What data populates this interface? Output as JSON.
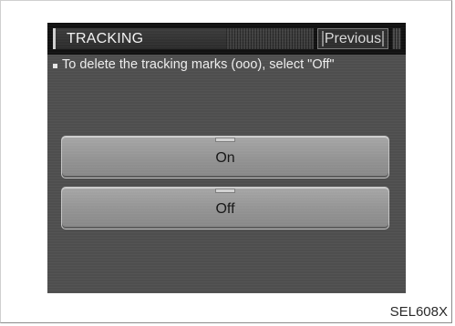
{
  "screen": {
    "title": "TRACKING",
    "previous_label": "Previous",
    "instruction": "To delete the tracking marks (ooo), select \"Off\"",
    "options": [
      {
        "label": "On",
        "selected": false
      },
      {
        "label": "Off",
        "selected": false
      }
    ]
  },
  "figure_code": "SEL608X"
}
